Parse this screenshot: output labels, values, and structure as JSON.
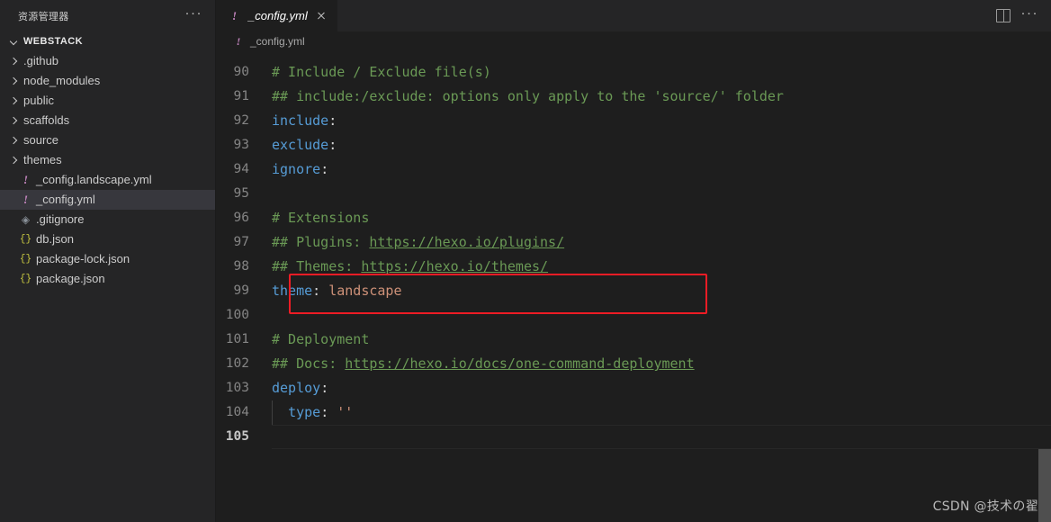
{
  "sidebar": {
    "title": "资源管理器",
    "more_icon": "···",
    "project": {
      "name": "WEBSTACK",
      "expanded": true
    },
    "items": [
      {
        "label": ".github",
        "type": "folder",
        "icon": "chevron-right-icon",
        "selected": false
      },
      {
        "label": "node_modules",
        "type": "folder",
        "icon": "chevron-right-icon",
        "selected": false
      },
      {
        "label": "public",
        "type": "folder",
        "icon": "chevron-right-icon",
        "selected": false
      },
      {
        "label": "scaffolds",
        "type": "folder",
        "icon": "chevron-right-icon",
        "selected": false
      },
      {
        "label": "source",
        "type": "folder",
        "icon": "chevron-right-icon",
        "selected": false
      },
      {
        "label": "themes",
        "type": "folder",
        "icon": "chevron-right-icon",
        "selected": false
      },
      {
        "label": "_config.landscape.yml",
        "type": "file",
        "icon": "yaml-icon",
        "selected": false
      },
      {
        "label": "_config.yml",
        "type": "file",
        "icon": "yaml-icon",
        "selected": true
      },
      {
        "label": ".gitignore",
        "type": "file",
        "icon": "git-icon",
        "selected": false
      },
      {
        "label": "db.json",
        "type": "file",
        "icon": "json-icon",
        "selected": false
      },
      {
        "label": "package-lock.json",
        "type": "file",
        "icon": "json-icon",
        "selected": false
      },
      {
        "label": "package.json",
        "type": "file",
        "icon": "json-icon",
        "selected": false
      }
    ]
  },
  "tabs": [
    {
      "label": "_config.yml",
      "icon": "yaml-icon",
      "active": true,
      "preview": true,
      "close_icon": "close-icon"
    }
  ],
  "tab_actions": {
    "split_icon": "split-editor-icon",
    "more_icon": "···"
  },
  "breadcrumb": {
    "icon": "yaml-icon",
    "label": "_config.yml"
  },
  "editor": {
    "language": "yaml",
    "active_line": 105,
    "lines": [
      {
        "n": 90,
        "tokens": [
          {
            "t": "# Include / Exclude file(s)",
            "c": "cm"
          }
        ]
      },
      {
        "n": 91,
        "tokens": [
          {
            "t": "## include:/exclude: options only apply to the 'source/' folder",
            "c": "cm"
          }
        ]
      },
      {
        "n": 92,
        "tokens": [
          {
            "t": "include",
            "c": "key"
          },
          {
            "t": ":",
            "c": "pun"
          }
        ]
      },
      {
        "n": 93,
        "tokens": [
          {
            "t": "exclude",
            "c": "key"
          },
          {
            "t": ":",
            "c": "pun"
          }
        ]
      },
      {
        "n": 94,
        "tokens": [
          {
            "t": "ignore",
            "c": "key"
          },
          {
            "t": ":",
            "c": "pun"
          }
        ]
      },
      {
        "n": 95,
        "tokens": []
      },
      {
        "n": 96,
        "tokens": [
          {
            "t": "# Extensions",
            "c": "cm"
          }
        ]
      },
      {
        "n": 97,
        "tokens": [
          {
            "t": "## Plugins: ",
            "c": "cm"
          },
          {
            "t": "https://hexo.io/plugins/",
            "c": "lnk"
          }
        ]
      },
      {
        "n": 98,
        "tokens": [
          {
            "t": "## Themes: ",
            "c": "cm"
          },
          {
            "t": "https://hexo.io/themes/",
            "c": "lnk"
          }
        ]
      },
      {
        "n": 99,
        "tokens": [
          {
            "t": "theme",
            "c": "key"
          },
          {
            "t": ": ",
            "c": "pun"
          },
          {
            "t": "landscape",
            "c": "str"
          }
        ],
        "highlighted": true
      },
      {
        "n": 100,
        "tokens": []
      },
      {
        "n": 101,
        "tokens": [
          {
            "t": "# Deployment",
            "c": "cm"
          }
        ]
      },
      {
        "n": 102,
        "tokens": [
          {
            "t": "## Docs: ",
            "c": "cm"
          },
          {
            "t": "https://hexo.io/docs/one-command-deployment",
            "c": "lnk"
          }
        ]
      },
      {
        "n": 103,
        "tokens": [
          {
            "t": "deploy",
            "c": "key"
          },
          {
            "t": ":",
            "c": "pun"
          }
        ]
      },
      {
        "n": 104,
        "tokens": [
          {
            "t": "  ",
            "c": "pun"
          },
          {
            "t": "type",
            "c": "key"
          },
          {
            "t": ": ",
            "c": "pun"
          },
          {
            "t": "''",
            "c": "str"
          }
        ],
        "indent_guide": true
      },
      {
        "n": 105,
        "tokens": [],
        "active": true
      }
    ],
    "annotation": {
      "shape": "rectangle",
      "color": "#ee1c25",
      "target_line": 99
    }
  },
  "watermark": {
    "text": "CSDN @技术の翟"
  },
  "colors": {
    "editor_bg": "#1e1e1e",
    "sidebar_bg": "#252526",
    "selected_row": "#37373d",
    "comment": "#6a9955",
    "key": "#569cd6",
    "string": "#ce9178",
    "line_number": "#858585",
    "annotation": "#ee1c25"
  }
}
